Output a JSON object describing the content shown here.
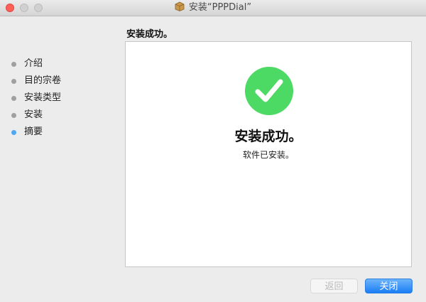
{
  "window": {
    "title": "安装“PPPDial”",
    "icon": "package-icon"
  },
  "sidebar": {
    "steps": [
      {
        "label": "介绍",
        "active": false
      },
      {
        "label": "目的宗卷",
        "active": false
      },
      {
        "label": "安装类型",
        "active": false
      },
      {
        "label": "安装",
        "active": false
      },
      {
        "label": "摘要",
        "active": true
      }
    ]
  },
  "main": {
    "header": "安装成功。",
    "success_title": "安装成功。",
    "success_subtitle": "软件已安装。"
  },
  "buttons": {
    "back": "返回",
    "close": "关闭"
  },
  "colors": {
    "success_green": "#4cd964",
    "accent_blue": "#1b7ef5",
    "active_bullet": "#4da8f4"
  }
}
